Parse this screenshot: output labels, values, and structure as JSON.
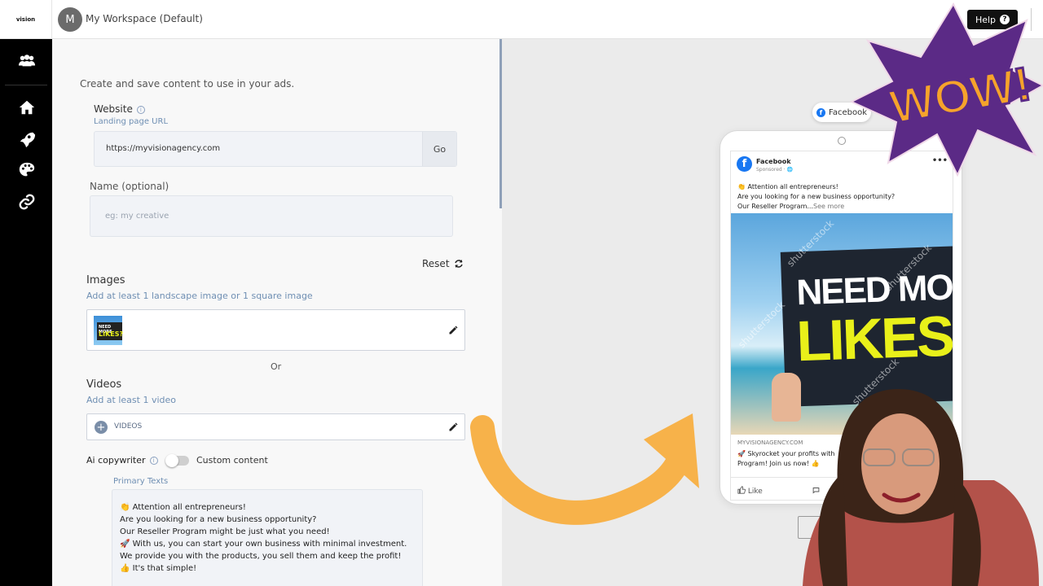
{
  "brand": {
    "logo_text": "vision"
  },
  "topbar": {
    "workspace_initial": "M",
    "workspace_name": "My Workspace (Default)",
    "help_label": "Help"
  },
  "sidebar": {
    "items": [
      {
        "name": "team",
        "icon": "users-icon"
      },
      {
        "name": "home",
        "icon": "home-icon"
      },
      {
        "name": "campaigns",
        "icon": "rocket-icon"
      },
      {
        "name": "creatives",
        "icon": "palette-icon"
      },
      {
        "name": "links",
        "icon": "link-icon"
      }
    ]
  },
  "form": {
    "intro": "Create and save content to use in your ads.",
    "website": {
      "label": "Website",
      "sublabel": "Landing page URL",
      "value": "https://myvisionagency.com",
      "go_label": "Go"
    },
    "name": {
      "label": "Name (optional)",
      "placeholder": "eg: my creative"
    },
    "reset_label": "Reset",
    "images": {
      "label": "Images",
      "sublabel": "Add at least 1 landscape image or 1 square image"
    },
    "or_label": "Or",
    "videos": {
      "label": "Videos",
      "sublabel": "Add at least 1 video",
      "add_label": "VIDEOS"
    },
    "ai_copywriter": {
      "label": "Ai copywriter",
      "toggle_on": false,
      "mode_label": "Custom content"
    },
    "primary_texts": {
      "label": "Primary Texts",
      "lines": [
        "👏 Attention all entrepreneurs!",
        "Are you looking for a new business opportunity?",
        "Our Reseller Program might be just what you need!",
        "🚀 With us, you can start your own business with minimal investment.",
        "We provide you with the products, you sell them and keep the profit!",
        "👍 It's that simple!"
      ]
    }
  },
  "preview": {
    "platform_label": "Facebook",
    "post": {
      "page_name": "Facebook",
      "sponsored": "Sponsored · 🌐",
      "text_lines": [
        "👏 Attention all entrepreneurs!",
        "Are you looking for a new business opportunity?",
        "Our Reseller Program..."
      ],
      "see_more": "See more",
      "image_line1": "NEED MORE",
      "image_line2": "LIKES?",
      "watermark": "shutterstock",
      "domain": "MYVISIONAGENCY.COM",
      "headline_lines": [
        "🚀 Skyrocket your profits with",
        "Program! Join us now! 👍"
      ],
      "like_label": "Like"
    }
  },
  "overlay": {
    "burst_text": "WOW!"
  },
  "colors": {
    "accent_link": "#6f8fb3",
    "arrow": "#f7b24a",
    "burst_purple": "#5b2a86",
    "burst_orange": "#f6a32b",
    "facebook_blue": "#1877f2"
  }
}
